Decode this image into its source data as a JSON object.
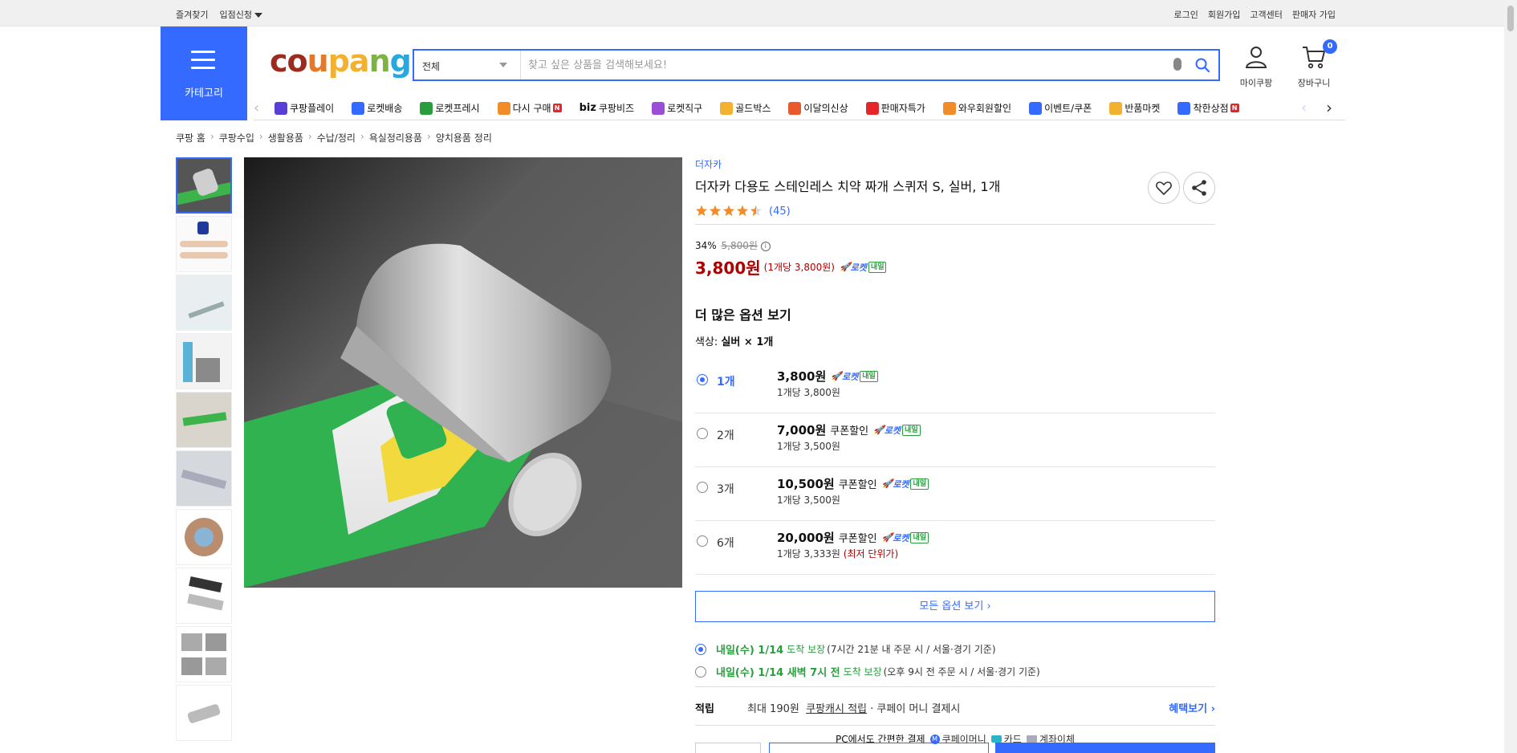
{
  "topbar": {
    "left": [
      "즐겨찾기",
      "입점신청"
    ],
    "right": [
      "로그인",
      "회원가입",
      "고객센터",
      "판매자 가입"
    ]
  },
  "header": {
    "category_label": "카테고리",
    "search_category": "전체",
    "search_placeholder": "찾고 싶은 상품을 검색해보세요!",
    "mycoupang_label": "마이쿠팡",
    "cart_label": "장바구니",
    "cart_count": "0"
  },
  "nav": {
    "items": [
      {
        "label": "쿠팡플레이",
        "icon": "play-icon",
        "color": "#5a3fd6"
      },
      {
        "label": "로켓배송",
        "icon": "rocket-icon",
        "color": "#346aff"
      },
      {
        "label": "로켓프레시",
        "icon": "rocket-fresh-icon",
        "color": "#2a9d3e"
      },
      {
        "label": "다시 구매",
        "icon": "rebuy-icon",
        "color": "#f28c28",
        "badge": "N"
      },
      {
        "label": "쿠팡비즈",
        "prefix": "biz",
        "icon": "biz-icon",
        "color": "#111"
      },
      {
        "label": "로켓직구",
        "icon": "rocket-global-icon",
        "color": "#9b4fd6"
      },
      {
        "label": "골드박스",
        "icon": "goldbox-icon",
        "color": "#f2b230"
      },
      {
        "label": "이달의신상",
        "icon": "new-bag-icon",
        "color": "#e85a2b"
      },
      {
        "label": "판매자특가",
        "icon": "seller-sale-icon",
        "color": "#e52528"
      },
      {
        "label": "와우회원할인",
        "icon": "wow-icon",
        "color": "#f28c28"
      },
      {
        "label": "이벤트/쿠폰",
        "icon": "coupon-icon",
        "color": "#346aff"
      },
      {
        "label": "반품마켓",
        "icon": "return-market-icon",
        "color": "#f2b230"
      },
      {
        "label": "착한상점",
        "icon": "good-store-icon",
        "color": "#346aff",
        "badge": "N"
      }
    ]
  },
  "breadcrumb": [
    "쿠팡 홈",
    "쿠팡수입",
    "생활용품",
    "수납/정리",
    "욕실정리용품",
    "양치용품 정리"
  ],
  "product": {
    "brand": "더자카",
    "title": "더자카 다용도 스테인레스 치약 짜개 스퀴저 S, 실버, 1개",
    "rating": 4.5,
    "review_count": "(45)",
    "discount": "34%",
    "original_price": "5,800원",
    "price": "3,800원",
    "unit_price": "(1개당 3,800원)",
    "rocket_label": "로켓",
    "rocket_tag": "내일",
    "more_options": "더 많은 옵션 보기",
    "color_label": "색상:",
    "color_value": "실버 × 1개",
    "options": [
      {
        "qty": "1개",
        "price": "3,800원",
        "coupon": "",
        "each": "1개당 3,800원",
        "best": "",
        "selected": true
      },
      {
        "qty": "2개",
        "price": "7,000원",
        "coupon": "쿠폰할인",
        "each": "1개당 3,500원",
        "best": "",
        "selected": false
      },
      {
        "qty": "3개",
        "price": "10,500원",
        "coupon": "쿠폰할인",
        "each": "1개당 3,500원",
        "best": "",
        "selected": false
      },
      {
        "qty": "6개",
        "price": "20,000원",
        "coupon": "쿠폰할인",
        "each": "1개당 3,333원",
        "best": "(최저 단위가)",
        "selected": false
      }
    ],
    "all_options": "모든 옵션 보기",
    "delivery": [
      {
        "date": "내일(수) 1/14",
        "suffix": "도착 보장",
        "note": "(7시간 21분 내 주문 시 / 서울·경기 기준)",
        "selected": true
      },
      {
        "date": "내일(수) 1/14 새벽 7시 전",
        "suffix": "도착 보장",
        "note": "(오후 9시 전 주문 시 / 서울·경기 기준)",
        "selected": false
      }
    ],
    "earn_label": "적립",
    "earn_amount": "최대 190원",
    "earn_cash": "쿠팡캐시 적립",
    "earn_tail": "· 쿠페이 머니 결제시",
    "benefit_link": "혜택보기",
    "pay_title": "PC에서도 간편한 결제",
    "pay_methods": [
      "쿠페이머니",
      "카드",
      "계좌이체"
    ]
  }
}
